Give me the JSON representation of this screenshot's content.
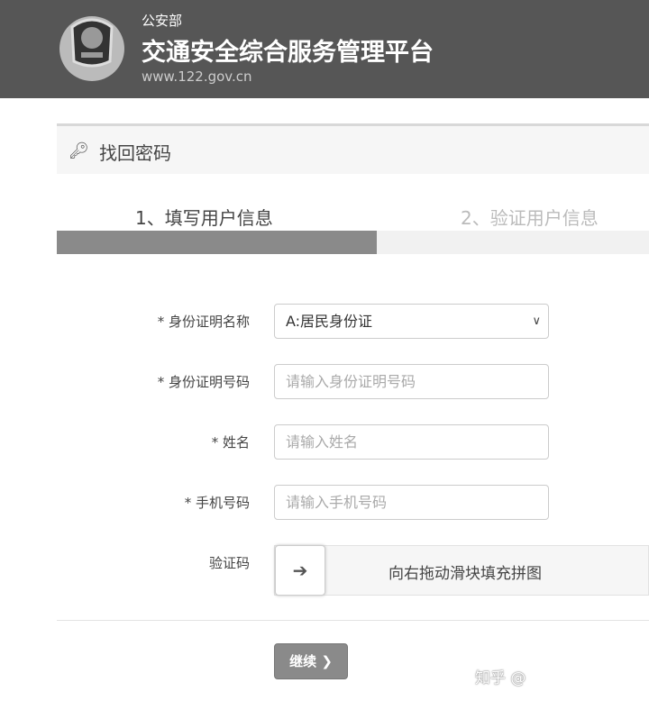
{
  "header": {
    "org": "公安部",
    "title": "交通安全综合服务管理平台",
    "url": "www.122.gov.cn"
  },
  "panel": {
    "title": "找回密码"
  },
  "steps": [
    {
      "label": "1、填写用户信息"
    },
    {
      "label": "2、验证用户信息"
    }
  ],
  "progress": {
    "current_step": 1,
    "total_steps": 2,
    "fraction": 0.54
  },
  "form": {
    "id_type": {
      "label": "* 身份证明名称",
      "value": "A:居民身份证"
    },
    "id_number": {
      "label": "* 身份证明号码",
      "placeholder": "请输入身份证明号码"
    },
    "name": {
      "label": "* 姓名",
      "placeholder": "请输入姓名"
    },
    "phone": {
      "label": "* 手机号码",
      "placeholder": "请输入手机号码"
    },
    "captcha": {
      "label": "验证码",
      "hint": "向右拖动滑块填充拼图",
      "handle_glyph": "➔"
    }
  },
  "continue_button": {
    "label": "继续",
    "glyph": "❯"
  },
  "watermark": "知乎 @"
}
